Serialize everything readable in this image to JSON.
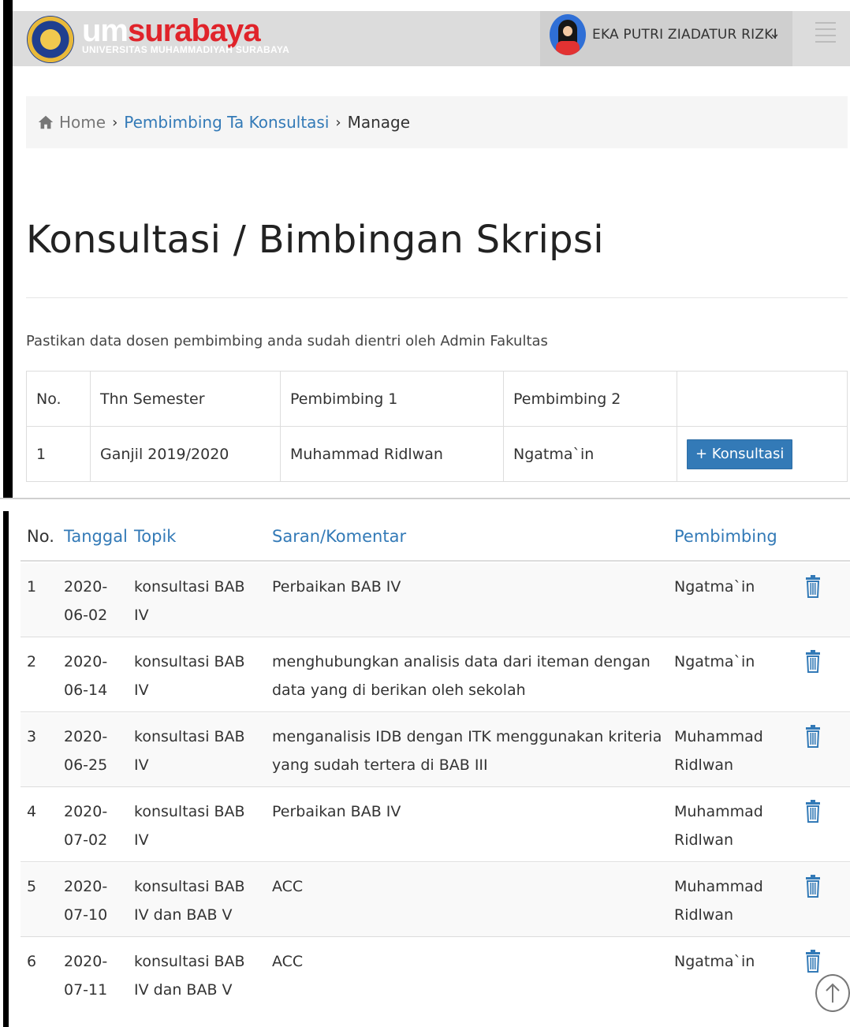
{
  "header": {
    "logo_um": "um",
    "logo_surabaya": "surabaya",
    "logo_subtitle": "UNIVERSITAS MUHAMMADIYAH SURABAYA",
    "user_name": "EKA PUTRI ZIADATUR RIZKI",
    "user_chevron": "⌄"
  },
  "breadcrumb": {
    "home": "Home",
    "sep": "›",
    "link": "Pembimbing Ta Konsultasi",
    "current": "Manage"
  },
  "page_title": "Konsultasi / Bimbingan Skripsi",
  "notice": "Pastikan data dosen pembimbing anda sudah dientri oleh Admin Fakultas",
  "pembimbing_table": {
    "headers": [
      "No.",
      "Thn Semester",
      "Pembimbing 1",
      "Pembimbing 2",
      ""
    ],
    "rows": [
      {
        "no": "1",
        "semester": "Ganjil 2019/2020",
        "p1": "Muhammad Ridlwan",
        "p2": "Ngatma`in",
        "button": "+ Konsultasi"
      }
    ]
  },
  "konsultasi_table": {
    "headers": {
      "no": "No.",
      "tanggal": "Tanggal",
      "topik": "Topik",
      "saran": "Saran/Komentar",
      "pembimbing": "Pembimbing"
    },
    "rows": [
      {
        "no": "1",
        "tanggal": "2020-06-02",
        "topik": "konsultasi BAB IV",
        "saran": "Perbaikan BAB IV",
        "pembimbing": "Ngatma`in"
      },
      {
        "no": "2",
        "tanggal": "2020-06-14",
        "topik": "konsultasi BAB IV",
        "saran": "menghubungkan analisis data dari iteman dengan data yang di berikan oleh sekolah",
        "pembimbing": "Ngatma`in"
      },
      {
        "no": "3",
        "tanggal": "2020-06-25",
        "topik": "konsultasi BAB IV",
        "saran": "menganalisis IDB dengan ITK menggunakan kriteria yang sudah tertera di BAB III",
        "pembimbing": "Muhammad Ridlwan"
      },
      {
        "no": "4",
        "tanggal": "2020-07-02",
        "topik": "konsultasi BAB IV",
        "saran": "Perbaikan BAB IV",
        "pembimbing": "Muhammad Ridlwan"
      },
      {
        "no": "5",
        "tanggal": "2020-07-10",
        "topik": "konsultasi BAB IV dan BAB V",
        "saran": "ACC",
        "pembimbing": "Muhammad Ridlwan"
      },
      {
        "no": "6",
        "tanggal": "2020-07-11",
        "topik": "konsultasi BAB IV dan BAB V",
        "saran": "ACC",
        "pembimbing": "Ngatma`in"
      }
    ]
  },
  "icons": {
    "home": "home-icon",
    "delete": "trash-icon",
    "scroll_top": "arrow-up-icon",
    "menu": "hamburger-icon"
  },
  "colors": {
    "link": "#337ab7",
    "brand_red": "#e0232a",
    "header_bg": "#dcdcdc"
  }
}
